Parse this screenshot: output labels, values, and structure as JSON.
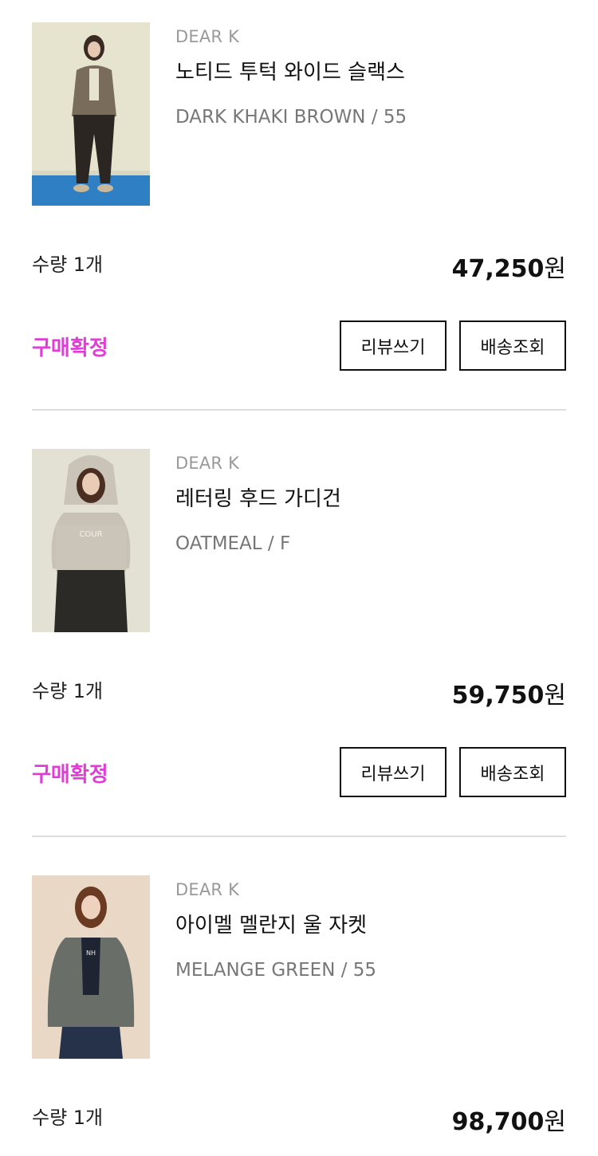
{
  "orders": [
    {
      "brand": "DEAR K",
      "title": "노티드 투턱 와이드 슬랙스",
      "option": "DARK KHAKI BROWN / 55",
      "quantity": "수량 1개",
      "price": "47,250",
      "currency": "원",
      "status": "구매확정",
      "review_label": "리뷰쓰기",
      "track_label": "배송조회"
    },
    {
      "brand": "DEAR K",
      "title": "레터링 후드 가디건",
      "option": "OATMEAL / F",
      "quantity": "수량 1개",
      "price": "59,750",
      "currency": "원",
      "status": "구매확정",
      "review_label": "리뷰쓰기",
      "track_label": "배송조회"
    },
    {
      "brand": "DEAR K",
      "title": "아이멜 멜란지 울 자켓",
      "option": "MELANGE GREEN / 55",
      "quantity": "수량 1개",
      "price": "98,700",
      "currency": "원"
    }
  ],
  "colors": {
    "status_accent": "#e13bd8",
    "divider": "#dddddd"
  }
}
